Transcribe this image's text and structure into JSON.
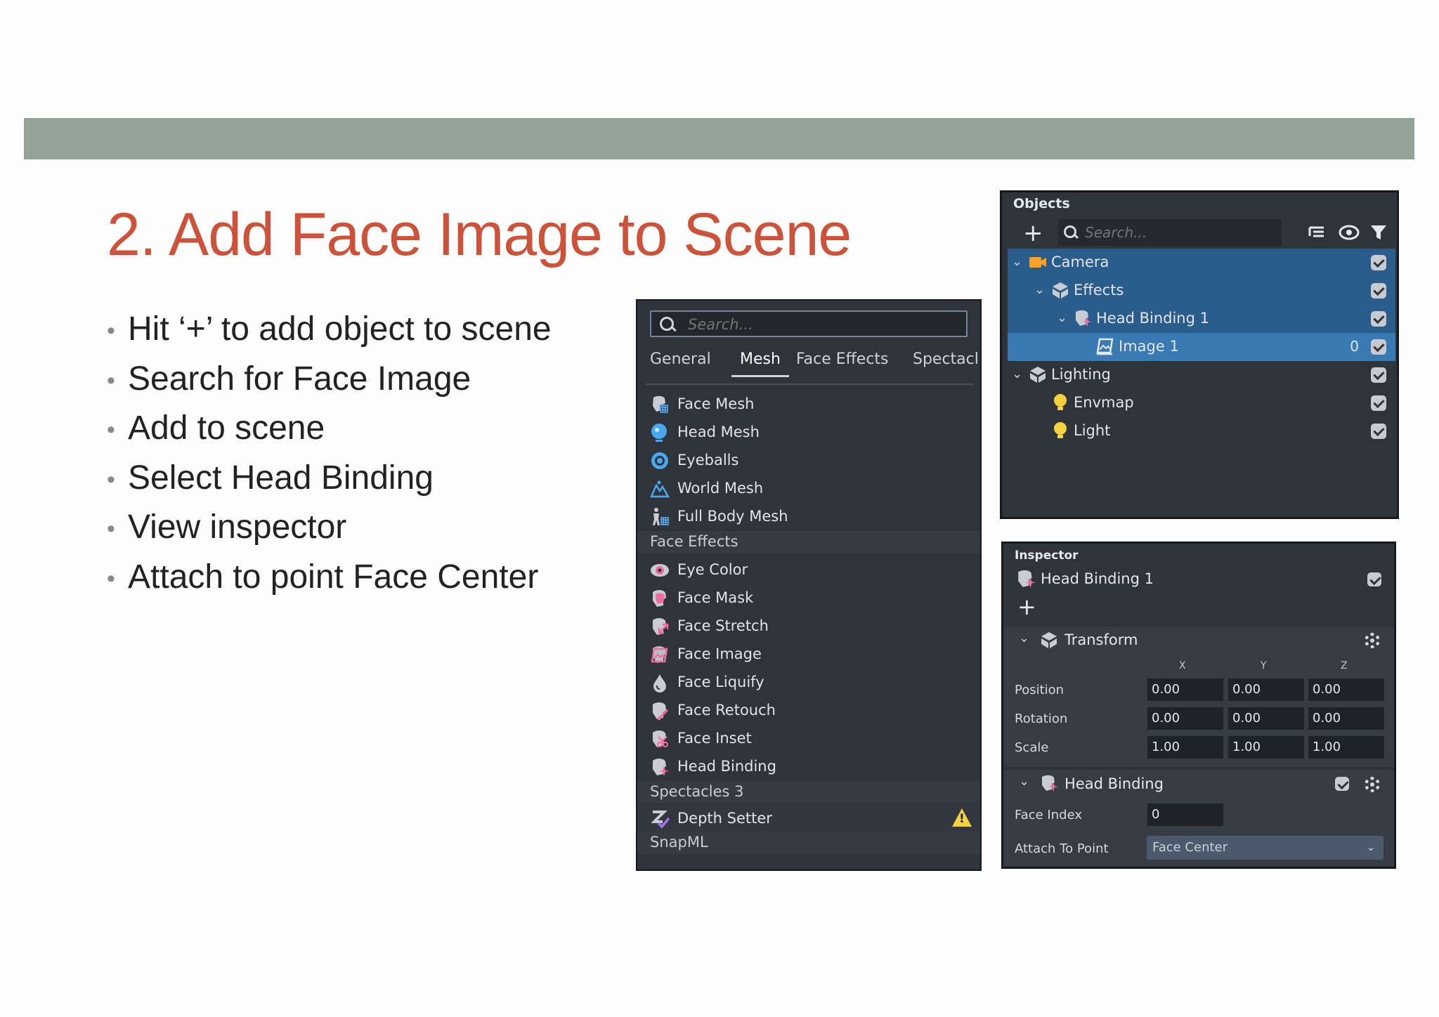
{
  "slide": {
    "title": "2. Add Face Image to Scene",
    "bullets": [
      "Hit ‘+’ to add object to scene",
      "Search for Face Image",
      "Add to scene",
      "Select Head Binding",
      "View inspector",
      "Attach to point Face Center"
    ],
    "accent_bar_color": "#93a497",
    "title_color": "#cc5339"
  },
  "add_panel": {
    "search_placeholder": "Search...",
    "tabs": [
      "General",
      "Mesh",
      "Face Effects",
      "Spectacl"
    ],
    "active_tab": "Mesh",
    "mesh_items": [
      {
        "label": "Face Mesh",
        "icon": "face-mesh-icon"
      },
      {
        "label": "Head Mesh",
        "icon": "head-mesh-icon"
      },
      {
        "label": "Eyeballs",
        "icon": "eyeballs-icon"
      },
      {
        "label": "World Mesh",
        "icon": "world-mesh-icon"
      },
      {
        "label": "Full Body Mesh",
        "icon": "full-body-mesh-icon"
      }
    ],
    "face_effects_header": "Face Effects",
    "face_effects_items": [
      {
        "label": "Eye Color",
        "icon": "eye-color-icon"
      },
      {
        "label": "Face Mask",
        "icon": "face-mask-icon"
      },
      {
        "label": "Face Stretch",
        "icon": "face-stretch-icon"
      },
      {
        "label": "Face Image",
        "icon": "face-image-icon"
      },
      {
        "label": "Face Liquify",
        "icon": "face-liquify-icon"
      },
      {
        "label": "Face Retouch",
        "icon": "face-retouch-icon"
      },
      {
        "label": "Face Inset",
        "icon": "face-inset-icon"
      },
      {
        "label": "Head Binding",
        "icon": "head-binding-icon"
      }
    ],
    "spectacles_header": "Spectacles 3",
    "spectacles_items": [
      {
        "label": "Depth Setter",
        "icon": "depth-setter-icon",
        "warning": true
      }
    ],
    "snapml_header": "SnapML"
  },
  "objects_panel": {
    "title": "Objects",
    "search_placeholder": "Search...",
    "rows": [
      {
        "label": "Camera",
        "depth": 0,
        "expanded": true,
        "icon": "camera-icon",
        "checked": true
      },
      {
        "label": "Effects",
        "depth": 1,
        "expanded": true,
        "icon": "scene-object-icon",
        "checked": true
      },
      {
        "label": "Head Binding 1",
        "depth": 2,
        "expanded": true,
        "icon": "head-binding-icon",
        "checked": true
      },
      {
        "label": "Image 1",
        "depth": 3,
        "icon": "image-icon",
        "checked": true,
        "selected": true,
        "layer": "0"
      },
      {
        "label": "Lighting",
        "depth": 0,
        "expanded": true,
        "icon": "scene-object-icon",
        "checked": true
      },
      {
        "label": "Envmap",
        "depth": 1,
        "icon": "light-bulb-icon",
        "checked": true
      },
      {
        "label": "Light",
        "depth": 1,
        "icon": "light-bulb-icon",
        "checked": true
      }
    ]
  },
  "inspector": {
    "title": "Inspector",
    "object_name": "Head Binding 1",
    "transform": {
      "title": "Transform",
      "axes": [
        "X",
        "Y",
        "Z"
      ],
      "rows": [
        {
          "label": "Position",
          "values": [
            "0.00",
            "0.00",
            "0.00"
          ]
        },
        {
          "label": "Rotation",
          "values": [
            "0.00",
            "0.00",
            "0.00"
          ]
        },
        {
          "label": "Scale",
          "values": [
            "1.00",
            "1.00",
            "1.00"
          ]
        }
      ]
    },
    "head_binding": {
      "title": "Head Binding",
      "face_index_label": "Face Index",
      "face_index_value": "0",
      "attach_label": "Attach To Point",
      "attach_value": "Face Center"
    }
  }
}
